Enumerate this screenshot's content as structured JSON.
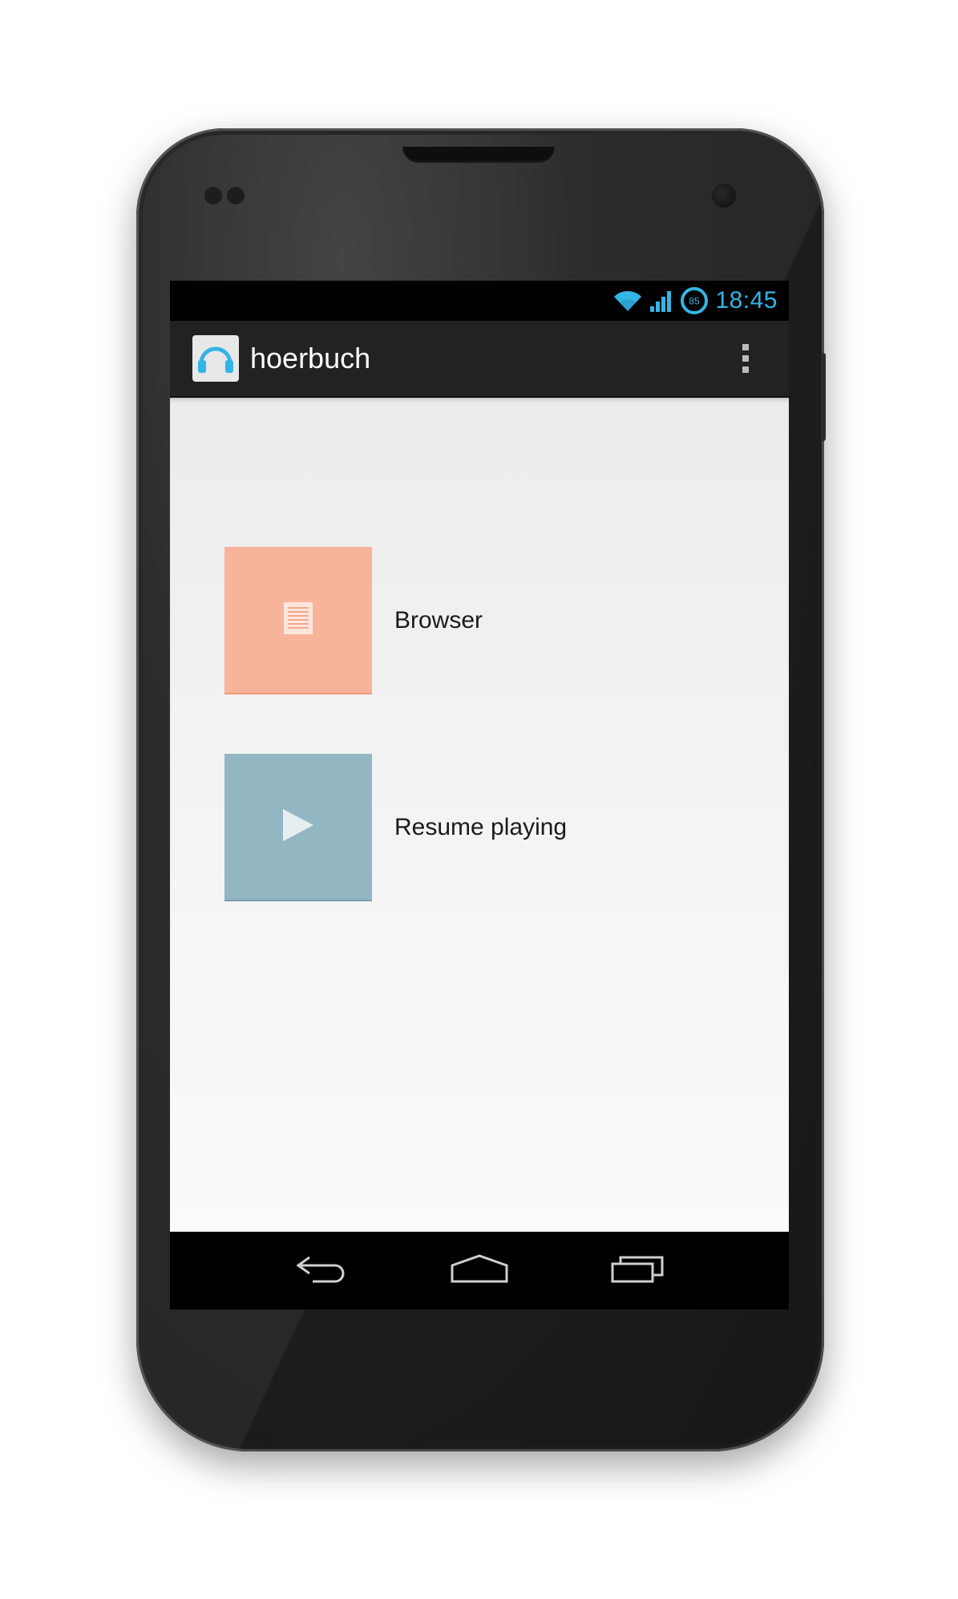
{
  "status_bar": {
    "time": "18:45",
    "battery_level": "85",
    "accent_color": "#33b5e5",
    "icons": [
      "wifi-icon",
      "cell-signal-icon",
      "battery-icon"
    ]
  },
  "action_bar": {
    "app_icon": "headphones-icon",
    "title": "hoerbuch",
    "overflow_icon": "overflow-menu-icon"
  },
  "menu": {
    "items": [
      {
        "label": "Browser",
        "icon": "document-icon",
        "color": "#f7b49a"
      },
      {
        "label": "Resume playing",
        "icon": "play-icon",
        "color": "#93b6c3"
      }
    ]
  },
  "nav_bar": {
    "buttons": [
      "back-icon",
      "home-icon",
      "recent-apps-icon"
    ]
  }
}
